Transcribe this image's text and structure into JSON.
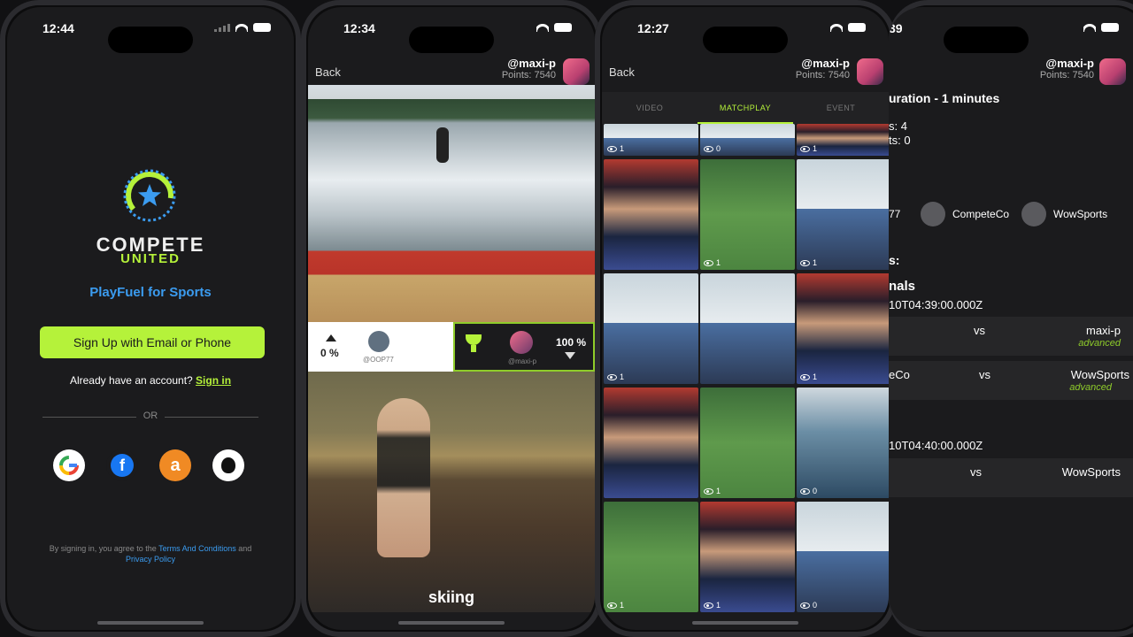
{
  "p1": {
    "time": "12:44",
    "brand_line1": "COMPETE",
    "brand_line2": "UNITED",
    "tagline": "PlayFuel for Sports",
    "signup": "Sign Up with Email or Phone",
    "already": "Already have an account?",
    "signin": "Sign in",
    "or": "OR",
    "legal_pre": "By signing in, you agree to the",
    "terms": "Terms And Conditions",
    "and": "and",
    "privacy": "Privacy Policy",
    "social": [
      "google-icon",
      "facebook-icon",
      "amazon-icon",
      "apple-icon"
    ]
  },
  "p2": {
    "time": "12:34",
    "back": "Back",
    "handle": "@maxi-p",
    "points": "Points: 7540",
    "left_pct": "0 %",
    "left_user": "@OOP77",
    "right_user": "@maxi-p",
    "right_pct": "100 %",
    "caption": "skiing"
  },
  "p3": {
    "time": "12:27",
    "back": "Back",
    "handle": "@maxi-p",
    "points": "Points: 7540",
    "tabs": [
      "VIDEO",
      "MATCHPLAY",
      "EVENT"
    ],
    "tiles": [
      {
        "t": "ski",
        "v": "1"
      },
      {
        "t": "ski",
        "v": "0"
      },
      {
        "t": "box",
        "v": "1"
      },
      {
        "t": "box",
        "v": ""
      },
      {
        "t": "foot",
        "v": "1"
      },
      {
        "t": "ski",
        "v": "1"
      },
      {
        "t": "ski",
        "v": "1"
      },
      {
        "t": "ski",
        "v": ""
      },
      {
        "t": "box",
        "v": "1"
      },
      {
        "t": "box",
        "v": ""
      },
      {
        "t": "foot",
        "v": "1"
      },
      {
        "t": "wave",
        "v": "0"
      },
      {
        "t": "foot",
        "v": "1"
      },
      {
        "t": "box",
        "v": "1"
      },
      {
        "t": "ski",
        "v": "0"
      }
    ]
  },
  "p4": {
    "time": "39",
    "handle": "@maxi-p",
    "points": "Points: 7540",
    "duration": "uration - 1 minutes",
    "s1": "s: 4",
    "s2": "ts: 0",
    "p_left": "77",
    "p_mid": "CompeteCo",
    "p_right": "WowSports",
    "sec_label": "s:",
    "finals": "nals",
    "ts1": "10T04:39:00.000Z",
    "m1_vs": "vs",
    "m1_right": "maxi-p",
    "m1_level": "advanced",
    "m2_left": "eCo",
    "m2_vs": "vs",
    "m2_right": "WowSports",
    "m2_level": "advanced",
    "ts2": "10T04:40:00.000Z",
    "m3_vs": "vs",
    "m3_right": "WowSports"
  }
}
